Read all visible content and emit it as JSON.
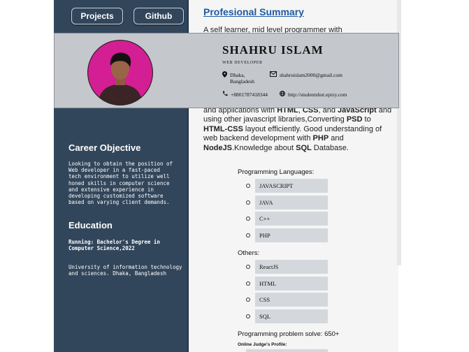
{
  "nav": {
    "projects": "Projects",
    "github": "Github"
  },
  "header": {
    "name": "SHAHRU ISLAM",
    "role": "WEB DEVELOPER",
    "location": "Dhaka, Bangladesh",
    "email": "shahruislam2000@gmail.com",
    "phone": "+8801787418344",
    "website": "http://studentshut.epizy.com"
  },
  "summary": {
    "title": "Profesional Summary",
    "intro": "A self learner, mid level programmer with",
    "parts": {
      "p1": "and applications with ",
      "html": "HTML",
      "p2": ", ",
      "css": "CSS",
      "p3": ", and ",
      "js": "JavaScript",
      "p4": " and using other javascript libraries,Converting ",
      "psd": "PSD",
      "p5": " to ",
      "htmlcss": "HTML-CSS",
      "p6": " layout efficiently. Good understanding of web backend development with ",
      "php": "PHP",
      "p7": " and ",
      "node": "NodeJS",
      "p8": ".Knowledge about ",
      "sql": "SQL",
      "p9": " Database."
    }
  },
  "skills": {
    "programming_title": "Programming Languages:",
    "programming": [
      "JAVASCRIPT",
      "JAVA",
      "C++",
      "PHP"
    ],
    "others_title": "Others:",
    "others": [
      "ReactJS",
      "HTML",
      "CSS",
      "SQL"
    ]
  },
  "problems": {
    "label": "Programming problem solve: 650+",
    "judge_label": "Online Judge's Profile:"
  },
  "career": {
    "title": "Career Objective",
    "text": "Looking to obtain the position of Web developer in a fast-paced tech environment to utilize well honed skills in computer science and extensive experience in developing customized software based on varying client demands."
  },
  "education": {
    "title": "Education",
    "label": "Running: Bachelor's Degree in Computer Science,2022",
    "text": "University of information technology and sciences. Dhaka, Bangladesh"
  },
  "colors": {
    "sidebar": "#32465b",
    "header_card": "#c4c7cb",
    "link": "#1f5aa0",
    "avatar_bg": "#d41e93"
  },
  "icons": {
    "location": "map-pin-icon",
    "email": "envelope-icon",
    "phone": "phone-icon",
    "website": "globe-icon"
  }
}
